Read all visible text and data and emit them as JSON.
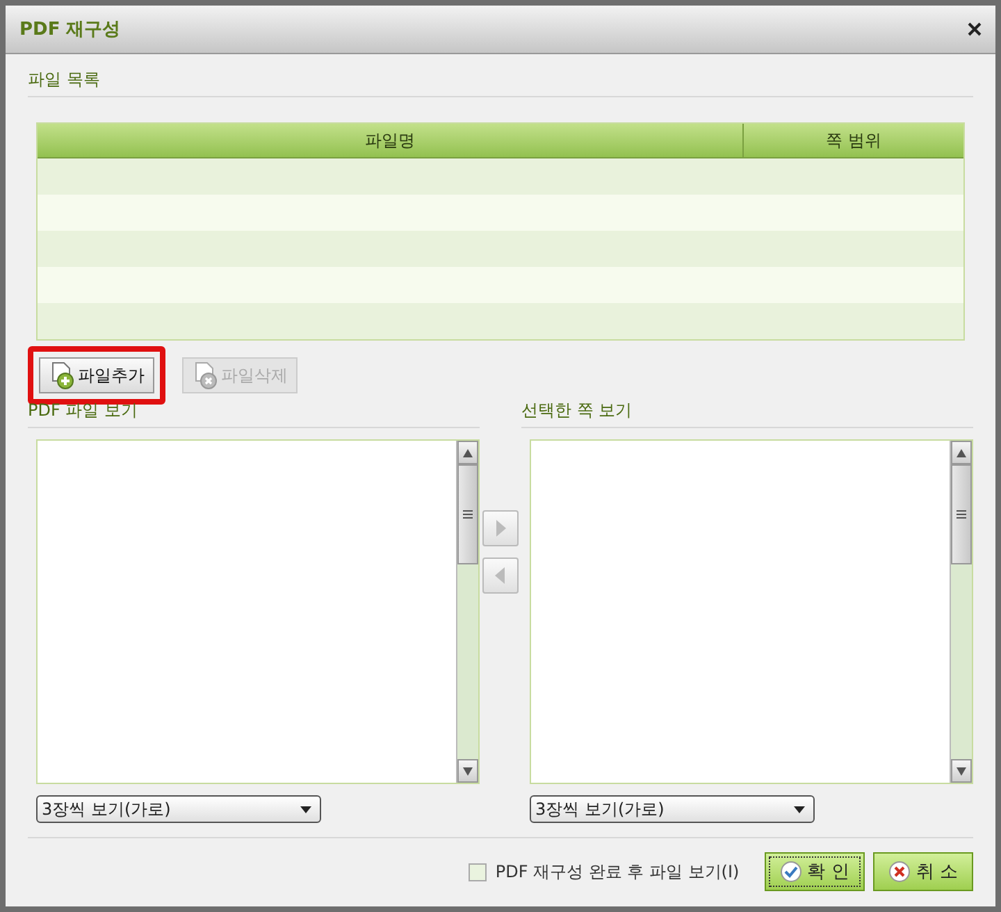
{
  "window": {
    "title": "PDF 재구성"
  },
  "file_list": {
    "label": "파일 목록",
    "columns": [
      "파일명",
      "쪽 범위"
    ]
  },
  "file_buttons": [
    {
      "label": "파일추가",
      "kind": "add",
      "disabled": false,
      "highlighted": true
    },
    {
      "label": "파일삭제",
      "kind": "delete",
      "disabled": true,
      "highlighted": false
    }
  ],
  "panels": [
    {
      "label": "PDF 파일 보기",
      "view_mode": "3장씩 보기(가로)"
    },
    {
      "label": "선택한 쪽 보기",
      "view_mode": "3장씩 보기(가로)"
    }
  ],
  "move_buttons": [
    {
      "kind": "right",
      "disabled": true
    },
    {
      "kind": "left",
      "disabled": true
    }
  ],
  "footer": {
    "checkbox": {
      "label": "PDF 재구성 완료 후 파일 보기(I)",
      "checked": false
    },
    "buttons": [
      {
        "label": "확 인",
        "kind": "ok"
      },
      {
        "label": "취 소",
        "kind": "cancel"
      }
    ]
  }
}
